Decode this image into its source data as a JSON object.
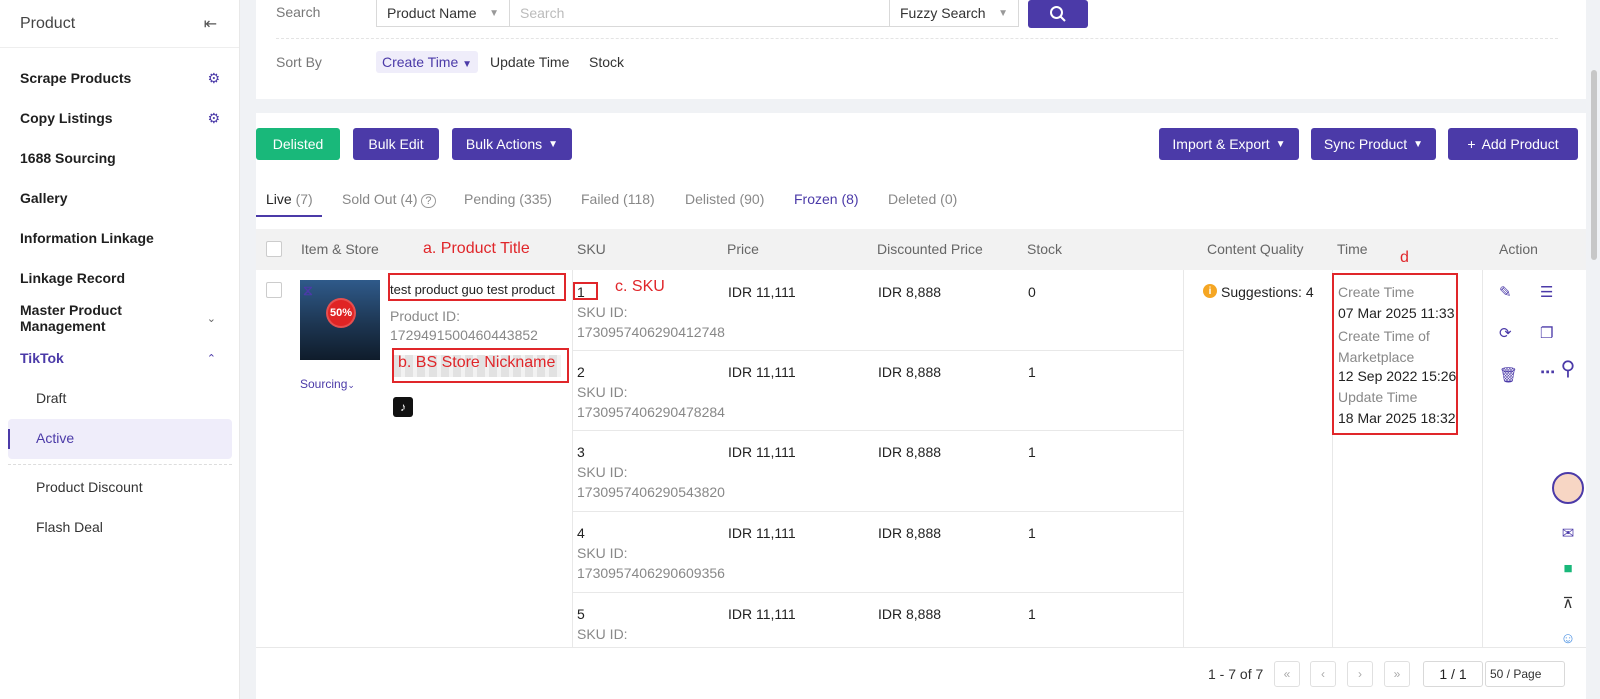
{
  "sidebar": {
    "title": "Product",
    "items": [
      {
        "label": "Scrape Products"
      },
      {
        "label": "Copy Listings"
      },
      {
        "label": "1688 Sourcing"
      },
      {
        "label": "Gallery"
      },
      {
        "label": "Information Linkage"
      },
      {
        "label": "Linkage Record"
      },
      {
        "label": "Master Product Management"
      },
      {
        "label": "TikTok"
      }
    ],
    "sub_items": [
      {
        "label": "Draft"
      },
      {
        "label": "Active"
      },
      {
        "label": "Product Discount"
      },
      {
        "label": "Flash Deal"
      }
    ]
  },
  "filters": {
    "search_label": "Search",
    "field_select": "Product Name",
    "search_placeholder": "Search",
    "mode_select": "Fuzzy Search",
    "sort_label": "Sort By",
    "sort_options": [
      "Create Time",
      "Update Time",
      "Stock"
    ]
  },
  "toolbar": {
    "delisted": "Delisted",
    "bulk_edit": "Bulk Edit",
    "bulk_actions": "Bulk Actions",
    "import_export": "Import & Export",
    "sync_product": "Sync Product",
    "add_product": "Add Product"
  },
  "tabs": [
    {
      "label": "Live",
      "count": "(7)"
    },
    {
      "label": "Sold Out",
      "count": "(4)"
    },
    {
      "label": "Pending",
      "count": "(335)"
    },
    {
      "label": "Failed",
      "count": "(118)"
    },
    {
      "label": "Delisted",
      "count": "(90)"
    },
    {
      "label": "Frozen",
      "count": "(8)"
    },
    {
      "label": "Deleted",
      "count": "(0)"
    }
  ],
  "table": {
    "headers": [
      "Item & Store",
      "SKU",
      "Price",
      "Discounted Price",
      "Stock",
      "Content Quality",
      "Time",
      "Action"
    ],
    "product": {
      "title": "test product guo test product",
      "product_id_label": "Product ID:",
      "product_id": "1729491500460443852",
      "sourcing": "Sourcing",
      "badge": "50%"
    },
    "skus": [
      {
        "sku": "1",
        "sku_id_label": "SKU ID:",
        "sku_id": "1730957406290412748",
        "price": "IDR 11,111",
        "discounted": "IDR 8,888",
        "stock": "0"
      },
      {
        "sku": "2",
        "sku_id_label": "SKU ID:",
        "sku_id": "1730957406290478284",
        "price": "IDR 11,111",
        "discounted": "IDR 8,888",
        "stock": "1"
      },
      {
        "sku": "3",
        "sku_id_label": "SKU ID:",
        "sku_id": "1730957406290543820",
        "price": "IDR 11,111",
        "discounted": "IDR 8,888",
        "stock": "1"
      },
      {
        "sku": "4",
        "sku_id_label": "SKU ID:",
        "sku_id": "1730957406290609356",
        "price": "IDR 11,111",
        "discounted": "IDR 8,888",
        "stock": "1"
      },
      {
        "sku": "5",
        "sku_id_label": "SKU ID:",
        "sku_id": "",
        "price": "IDR 11,111",
        "discounted": "IDR 8,888",
        "stock": "1"
      }
    ],
    "content_quality": "Suggestions: 4",
    "time": {
      "create_label": "Create Time",
      "create_value": "07 Mar 2025 11:33",
      "marketplace_label": "Create Time of Marketplace",
      "marketplace_value": "12 Sep 2022 15:26",
      "update_label": "Update Time",
      "update_value": "18 Mar 2025 18:32"
    }
  },
  "annotations": {
    "a": "a. Product Title",
    "b": "b. BS Store Nickname",
    "c": "c. SKU",
    "d": "d"
  },
  "pagination": {
    "range": "1 - 7 of 7",
    "page": "1 / 1",
    "per_page": "50 / Page"
  },
  "colors": {
    "accent": "#4b3aa8",
    "green": "#19b87a",
    "annotation_red": "#e0262a"
  }
}
